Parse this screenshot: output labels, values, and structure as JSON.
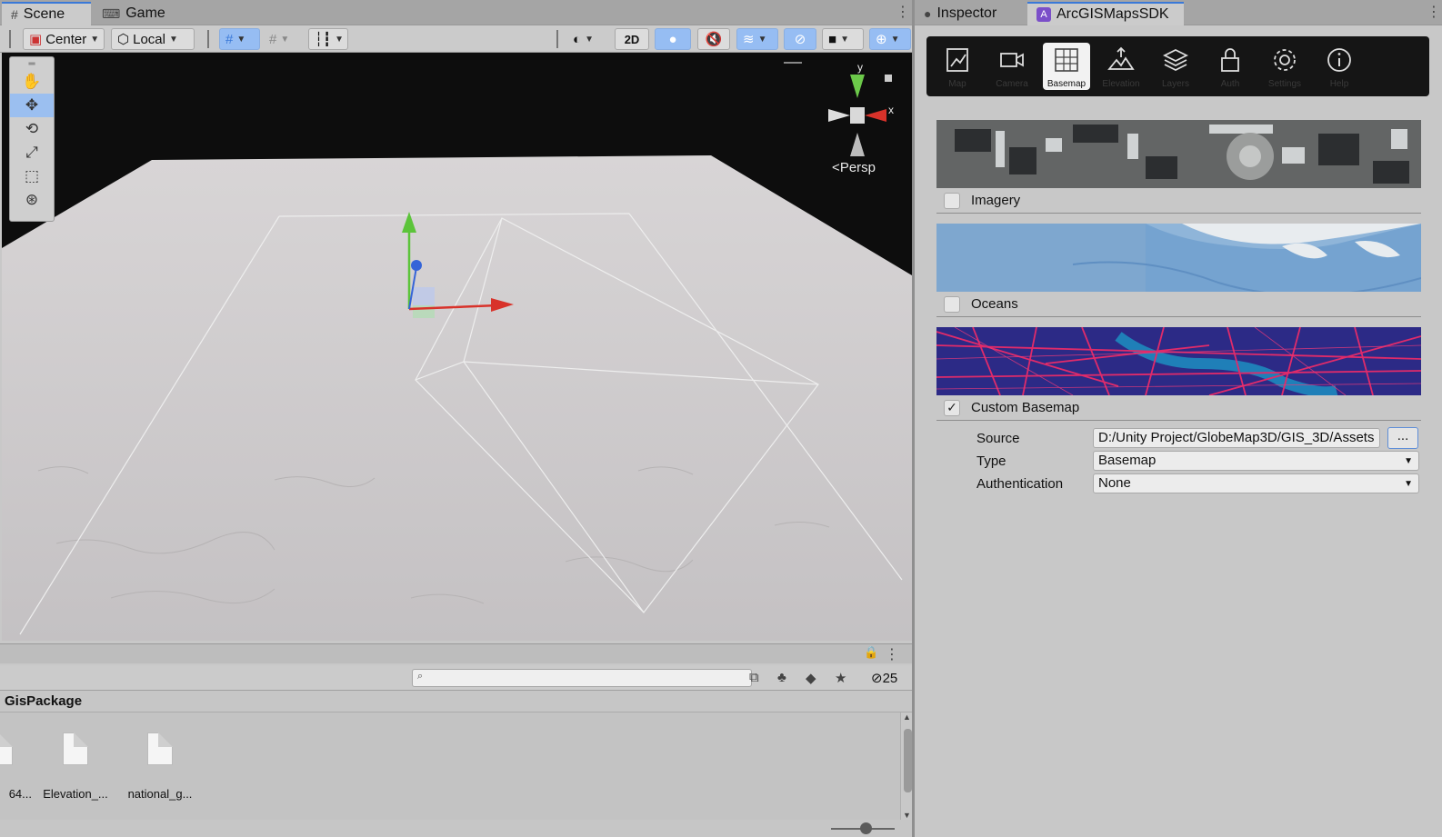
{
  "left_panel": {
    "tabs": [
      {
        "label": "Scene",
        "icon": "grid-icon"
      },
      {
        "label": "Game",
        "icon": "gamepad-icon"
      }
    ],
    "toolbar": {
      "pivot_label": "Center",
      "space_label": "Local",
      "mode_2d_label": "2D"
    },
    "scene": {
      "persp_label": "Persp",
      "axis_y": "y",
      "axis_x": "x"
    },
    "project": {
      "search_placeholder": "",
      "hidden_count": "25",
      "folder": "GisPackage",
      "files": [
        "64...",
        "Elevation_...",
        "national_g..."
      ]
    }
  },
  "right_panel": {
    "tabs": [
      {
        "label": "Inspector",
        "icon": "info-icon"
      },
      {
        "label": "ArcGISMapsSDK",
        "icon": "arcgis-icon"
      }
    ],
    "nav": [
      {
        "label": "Map",
        "icon": "map-icon"
      },
      {
        "label": "Camera",
        "icon": "camera-icon"
      },
      {
        "label": "Basemap",
        "icon": "basemap-icon"
      },
      {
        "label": "Elevation",
        "icon": "elevation-icon"
      },
      {
        "label": "Layers",
        "icon": "layers-icon"
      },
      {
        "label": "Auth",
        "icon": "lock-icon"
      },
      {
        "label": "Settings",
        "icon": "gear-icon"
      },
      {
        "label": "Help",
        "icon": "help-icon"
      }
    ],
    "basemaps": [
      {
        "label": "Imagery",
        "checked": false
      },
      {
        "label": "Oceans",
        "checked": false
      },
      {
        "label": "Custom Basemap",
        "checked": true
      }
    ],
    "custom": {
      "source_label": "Source",
      "source_value": "D:/Unity Project/GlobeMap3D/GIS_3D/Assets",
      "browse_label": "...",
      "type_label": "Type",
      "type_value": "Basemap",
      "auth_label": "Authentication",
      "auth_value": "None"
    }
  },
  "colors": {
    "accent": "#3a79d8",
    "selected_tool": "#9bbff0",
    "nav_bg": "#151515"
  }
}
